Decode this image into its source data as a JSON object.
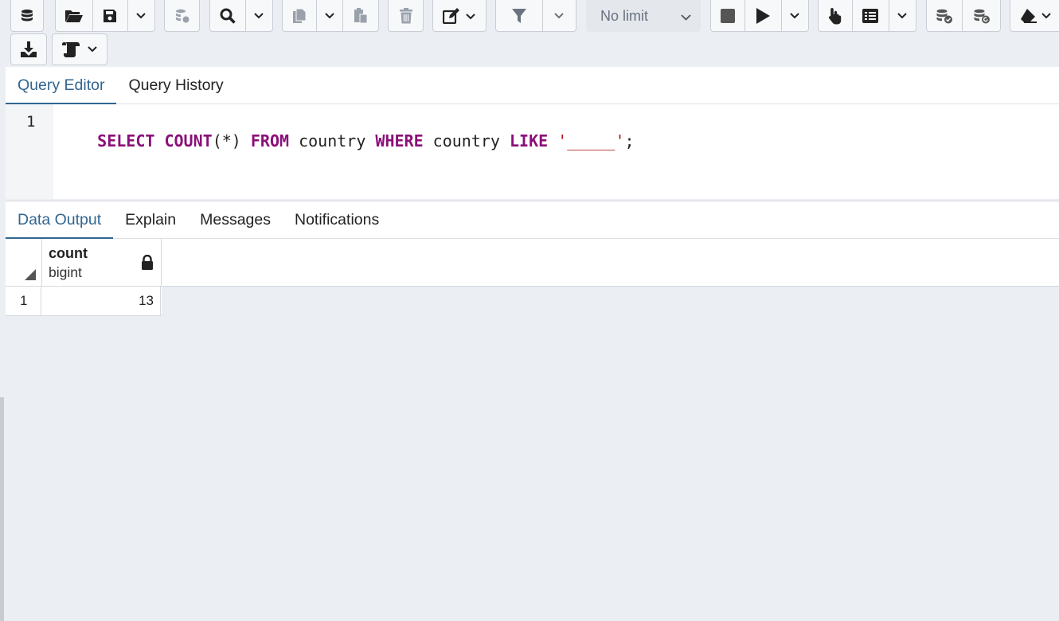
{
  "toolbar": {
    "row1": [
      {
        "group": "object-explorer",
        "buttons": [
          {
            "icon": "database-stack-icon"
          }
        ]
      },
      {
        "group": "file",
        "buttons": [
          {
            "icon": "folder-open-icon"
          },
          {
            "icon": "save-icon"
          },
          {
            "icon": "chevron-down-icon"
          }
        ]
      },
      {
        "group": "server",
        "buttons": [
          {
            "icon": "database-refresh-icon",
            "disabled": true
          }
        ]
      },
      {
        "group": "find",
        "buttons": [
          {
            "icon": "search-icon"
          },
          {
            "icon": "chevron-down-icon"
          }
        ]
      },
      {
        "group": "clipboard",
        "buttons": [
          {
            "icon": "copy-icon",
            "disabled": true
          },
          {
            "icon": "chevron-down-icon"
          },
          {
            "icon": "paste-icon",
            "disabled": true
          }
        ]
      },
      {
        "group": "delete",
        "buttons": [
          {
            "icon": "trash-icon",
            "disabled": true
          }
        ]
      },
      {
        "group": "edit",
        "buttons": [
          {
            "icon": "edit-icon"
          }
        ]
      },
      {
        "group": "filter",
        "buttons": [
          {
            "icon": "filter-icon",
            "disabled": true
          },
          {
            "icon": "chevron-down-icon",
            "disabled": true
          }
        ]
      },
      {
        "group": "execute",
        "buttons": [
          {
            "icon": "stop-icon",
            "disabled": true
          },
          {
            "icon": "play-icon"
          },
          {
            "icon": "chevron-down-icon"
          }
        ]
      },
      {
        "group": "explain",
        "buttons": [
          {
            "icon": "hand-pointer-icon"
          },
          {
            "icon": "list-icon"
          },
          {
            "icon": "chevron-down-icon"
          }
        ]
      },
      {
        "group": "transaction",
        "buttons": [
          {
            "icon": "commit-icon",
            "disabled": true
          },
          {
            "icon": "rollback-icon",
            "disabled": true
          }
        ]
      },
      {
        "group": "clear",
        "buttons": [
          {
            "icon": "eraser-icon"
          }
        ]
      }
    ],
    "row2": [
      {
        "group": "download",
        "buttons": [
          {
            "icon": "download-icon"
          }
        ]
      },
      {
        "group": "macros",
        "buttons": [
          {
            "icon": "scroll-icon"
          }
        ]
      }
    ],
    "limit": {
      "selected": "No limit"
    }
  },
  "editor_tabs": [
    {
      "label": "Query Editor",
      "active": true
    },
    {
      "label": "Query History",
      "active": false
    }
  ],
  "editor": {
    "line_number": "1",
    "tokens": [
      {
        "text": "SELECT",
        "kind": "kw"
      },
      {
        "text": " ",
        "kind": "plain"
      },
      {
        "text": "COUNT",
        "kind": "kw"
      },
      {
        "text": "(*)",
        "kind": "plain"
      },
      {
        "text": " ",
        "kind": "plain"
      },
      {
        "text": "FROM",
        "kind": "kw"
      },
      {
        "text": " country ",
        "kind": "plain"
      },
      {
        "text": "WHERE",
        "kind": "kw"
      },
      {
        "text": " country ",
        "kind": "plain"
      },
      {
        "text": "LIKE",
        "kind": "kw"
      },
      {
        "text": " ",
        "kind": "plain"
      },
      {
        "text": "'_____'",
        "kind": "str"
      },
      {
        "text": ";",
        "kind": "plain"
      }
    ]
  },
  "output_tabs": [
    {
      "label": "Data Output",
      "active": true
    },
    {
      "label": "Explain",
      "active": false
    },
    {
      "label": "Messages",
      "active": false
    },
    {
      "label": "Notifications",
      "active": false
    }
  ],
  "results": {
    "columns": [
      {
        "name": "count",
        "type": "bigint",
        "icon": "lock-icon"
      }
    ],
    "rows": [
      {
        "row_number": "1",
        "values": [
          "13"
        ]
      }
    ]
  },
  "colors": {
    "accent": "#326690",
    "keyword": "#8b0f79",
    "string": "#b3141f",
    "background": "#ebeef3"
  }
}
